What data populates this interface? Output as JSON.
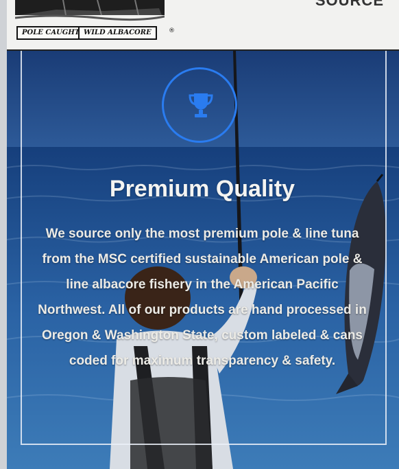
{
  "header": {
    "logo_tag_1": "POLE CAUGHT",
    "logo_tag_2": "WILD ALBACORE",
    "logo_registered": "®",
    "cut_text": "SOURCE"
  },
  "hero": {
    "icon": "trophy-icon",
    "title": "Premium Quality",
    "body": "We source only the most premium pole & line tuna from the MSC certified sustainable American pole & line albacore fishery in the American Pacific Northwest. All of our products are hand processed in Oregon & Washington State, custom labeled & cans coded for maximum transparency & safety."
  },
  "colors": {
    "accent": "#2a7cf0",
    "ocean": "#245a9a",
    "text": "#ecebe6"
  }
}
